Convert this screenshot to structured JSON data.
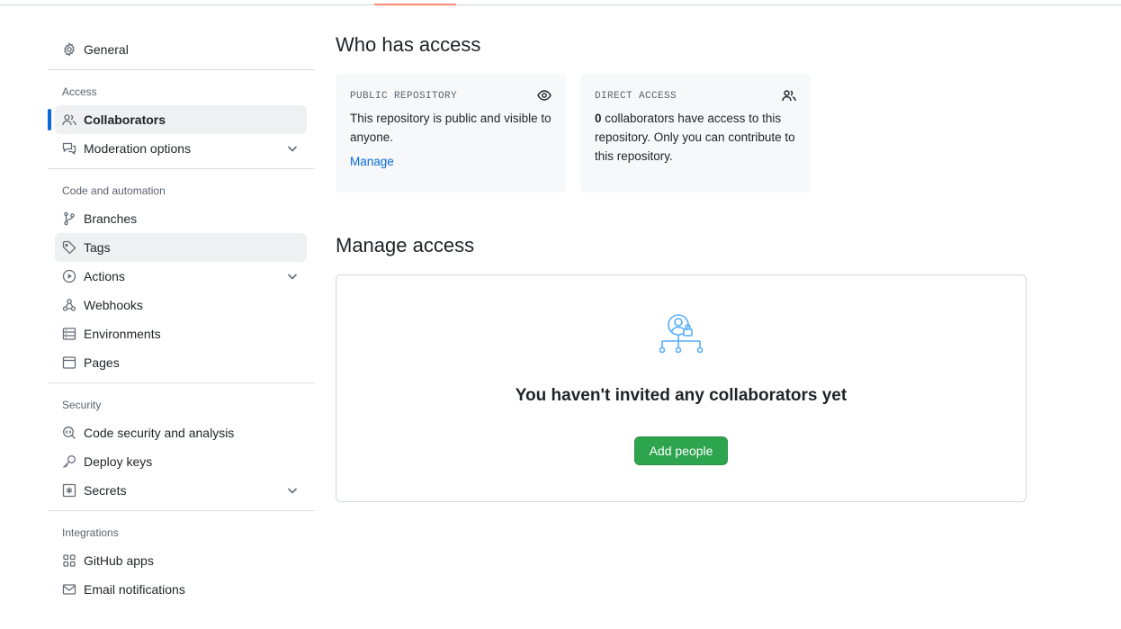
{
  "sidebar": {
    "general": "General",
    "groups": {
      "access": "Access",
      "code_automation": "Code and automation",
      "security": "Security",
      "integrations": "Integrations"
    },
    "items": {
      "collaborators": "Collaborators",
      "moderation": "Moderation options",
      "branches": "Branches",
      "tags": "Tags",
      "actions": "Actions",
      "webhooks": "Webhooks",
      "environments": "Environments",
      "pages": "Pages",
      "code_security": "Code security and analysis",
      "deploy_keys": "Deploy keys",
      "secrets": "Secrets",
      "github_apps": "GitHub apps",
      "email_notifications": "Email notifications"
    }
  },
  "main": {
    "who_title": "Who has access",
    "public_card": {
      "kicker": "PUBLIC REPOSITORY",
      "text": "This repository is public and visible to anyone.",
      "link": "Manage"
    },
    "direct_card": {
      "kicker": "DIRECT ACCESS",
      "count": "0",
      "text": " collaborators have access to this repository. Only you can contribute to this repository."
    },
    "manage_title": "Manage access",
    "empty_title": "You haven't invited any collaborators yet",
    "add_button": "Add people"
  },
  "colors": {
    "accent_underline": "#fd8c73",
    "active_bar": "#0969da",
    "link": "#0969da",
    "primary_button": "#2da44e",
    "illustration": "#54aeff"
  }
}
